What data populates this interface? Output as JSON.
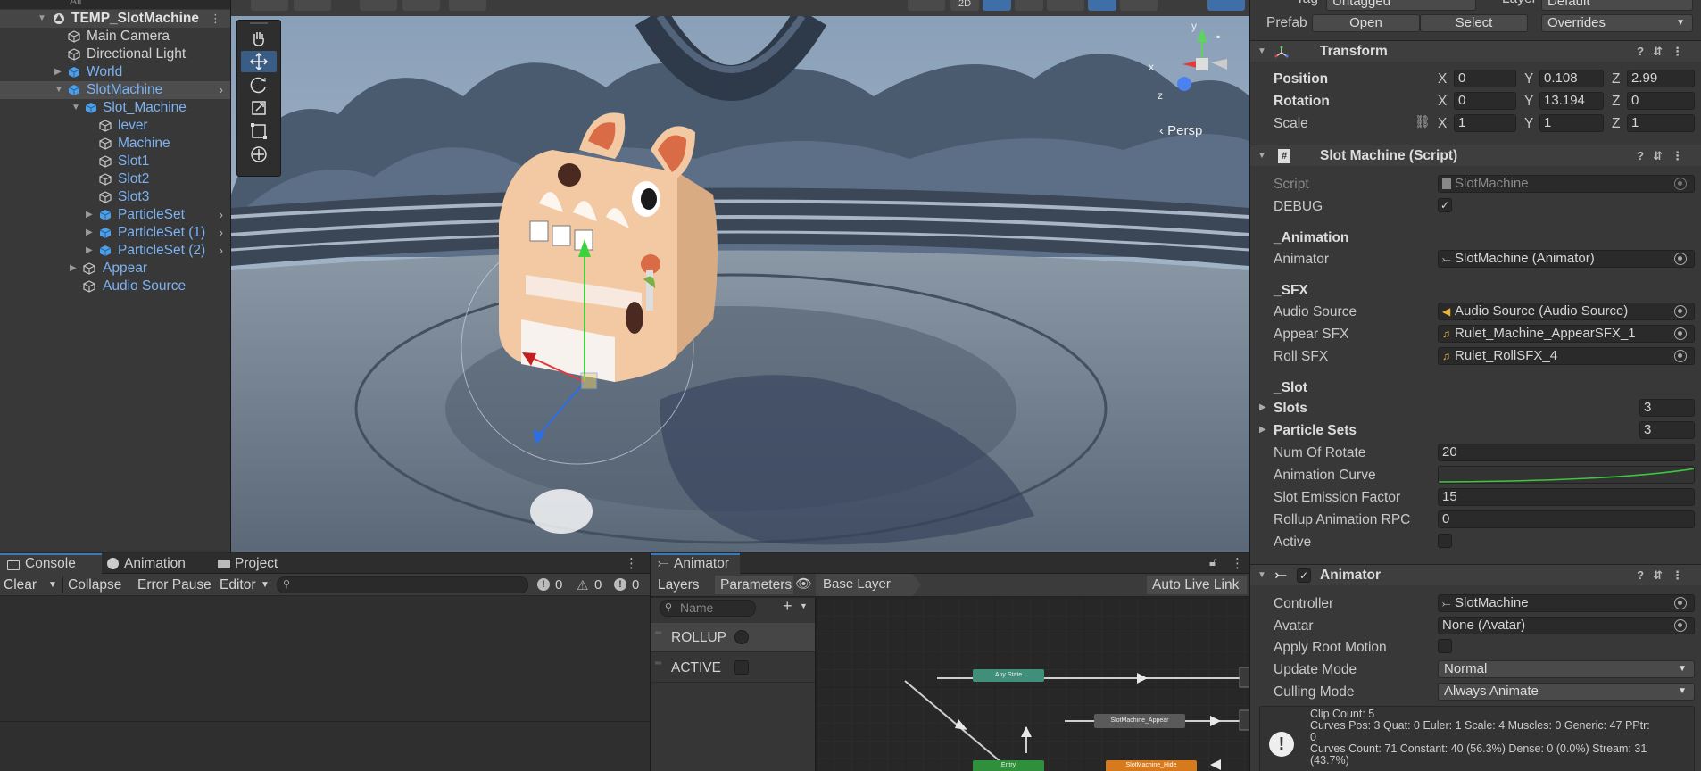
{
  "hierarchy": {
    "search_placeholder": "All",
    "items": [
      {
        "label": "TEMP_SlotMachine"
      },
      {
        "label": "Main Camera"
      },
      {
        "label": "Directional Light"
      },
      {
        "label": "World"
      },
      {
        "label": "SlotMachine"
      },
      {
        "label": "Slot_Machine"
      },
      {
        "label": "lever"
      },
      {
        "label": "Machine"
      },
      {
        "label": "Slot1"
      },
      {
        "label": "Slot2"
      },
      {
        "label": "Slot3"
      },
      {
        "label": "ParticleSet"
      },
      {
        "label": "ParticleSet (1)"
      },
      {
        "label": "ParticleSet (2)"
      },
      {
        "label": "Appear"
      },
      {
        "label": "Audio Source"
      }
    ]
  },
  "scene": {
    "toolbar_2d": "2D",
    "gizmo_y": "y",
    "gizmo_x": "x",
    "gizmo_z": "z",
    "persp_label": "Persp"
  },
  "console": {
    "tabs": [
      "Console",
      "Animation",
      "Project"
    ],
    "clear": "Clear",
    "collapse": "Collapse",
    "error_pause": "Error Pause",
    "editor": "Editor",
    "counts": [
      "0",
      "0",
      "0"
    ]
  },
  "animator": {
    "tab": "Animator",
    "layers": "Layers",
    "parameters": "Parameters",
    "base_layer": "Base Layer",
    "auto_live_link": "Auto Live Link",
    "search_placeholder": "Name",
    "params": [
      {
        "name": "ROLLUP",
        "type": "trigger"
      },
      {
        "name": "ACTIVE",
        "type": "bool"
      }
    ],
    "nodes": {
      "any_state": "Any State",
      "appear": "SlotMachine_Appear",
      "entry": "Entry",
      "hide": "SlotMachine_Hide"
    }
  },
  "inspector": {
    "tag_label": "Tag",
    "tag_value": "Untagged",
    "layer_label": "Layer",
    "layer_value": "Default",
    "prefab_label": "Prefab",
    "open": "Open",
    "select": "Select",
    "overrides": "Overrides",
    "transform": {
      "title": "Transform",
      "position": {
        "label": "Position",
        "x": "0",
        "y": "0.108",
        "z": "2.99"
      },
      "rotation": {
        "label": "Rotation",
        "x": "0",
        "y": "13.194",
        "z": "0"
      },
      "scale": {
        "label": "Scale",
        "x": "1",
        "y": "1",
        "z": "1"
      },
      "axis_x": "X",
      "axis_y": "Y",
      "axis_z": "Z"
    },
    "script_comp": {
      "title": "Slot Machine (Script)",
      "script_label": "Script",
      "script_value": "SlotMachine",
      "debug_label": "DEBUG",
      "debug_checked": true,
      "anim_header": "_Animation",
      "animator_label": "Animator",
      "animator_value": "SlotMachine (Animator)",
      "sfx_header": "_SFX",
      "audio_label": "Audio Source",
      "audio_value": "Audio Source (Audio Source)",
      "appear_label": "Appear SFX",
      "appear_value": "Rulet_Machine_AppearSFX_1",
      "roll_label": "Roll SFX",
      "roll_value": "Rulet_RollSFX_4",
      "slot_header": "_Slot",
      "slots_label": "Slots",
      "slots_value": "3",
      "psets_label": "Particle Sets",
      "psets_value": "3",
      "rotate_label": "Num Of Rotate",
      "rotate_value": "20",
      "curve_label": "Animation Curve",
      "emission_label": "Slot Emission Factor",
      "emission_value": "15",
      "rollup_label": "Rollup Animation RPC",
      "rollup_value": "0",
      "active_label": "Active",
      "active_checked": false
    },
    "animator_comp": {
      "title": "Animator",
      "controller_label": "Controller",
      "controller_value": "SlotMachine",
      "avatar_label": "Avatar",
      "avatar_value": "None (Avatar)",
      "root_label": "Apply Root Motion",
      "update_label": "Update Mode",
      "update_value": "Normal",
      "culling_label": "Culling Mode",
      "culling_value": "Always Animate",
      "info": [
        "Clip Count: 5",
        "Curves Pos: 3 Quat: 0 Euler: 1 Scale: 4 Muscles: 0 Generic: 47 PPtr:",
        "0",
        "Curves Count: 71 Constant: 40 (56.3%) Dense: 0 (0.0%) Stream: 31",
        "(43.7%)"
      ]
    }
  }
}
